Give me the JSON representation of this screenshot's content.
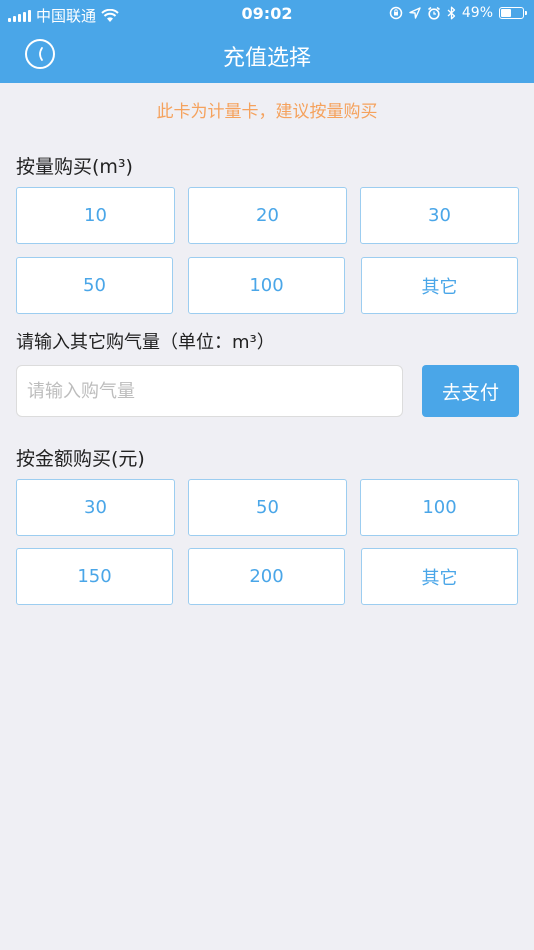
{
  "status_bar": {
    "carrier": "中国联通",
    "time": "09:02",
    "battery": "49%",
    "battery_level": 0.49,
    "icons": [
      "signal-icon",
      "wifi-icon",
      "lock-rotation-icon",
      "location-icon",
      "alarm-icon",
      "bluetooth-icon",
      "battery-icon"
    ]
  },
  "nav": {
    "title": "充值选择",
    "back_icon": "back-icon"
  },
  "notice": "此卡为计量卡，建议按量购买",
  "volume_section": {
    "title": "按量购买(m³)",
    "options": [
      "10",
      "20",
      "30",
      "50",
      "100",
      "其它"
    ]
  },
  "custom_volume": {
    "label": "请输入其它购气量（单位：m³）",
    "value": "",
    "placeholder": "请输入购气量",
    "pay_button": "去支付"
  },
  "money_section": {
    "title": "按金额购买(元)",
    "options": [
      "30",
      "50",
      "100",
      "150",
      "200",
      "其它"
    ]
  },
  "colors": {
    "accent": "#4aa6e8",
    "notice": "#f5a25d",
    "background": "#efeff4",
    "option_border": "#9ccdf0"
  }
}
